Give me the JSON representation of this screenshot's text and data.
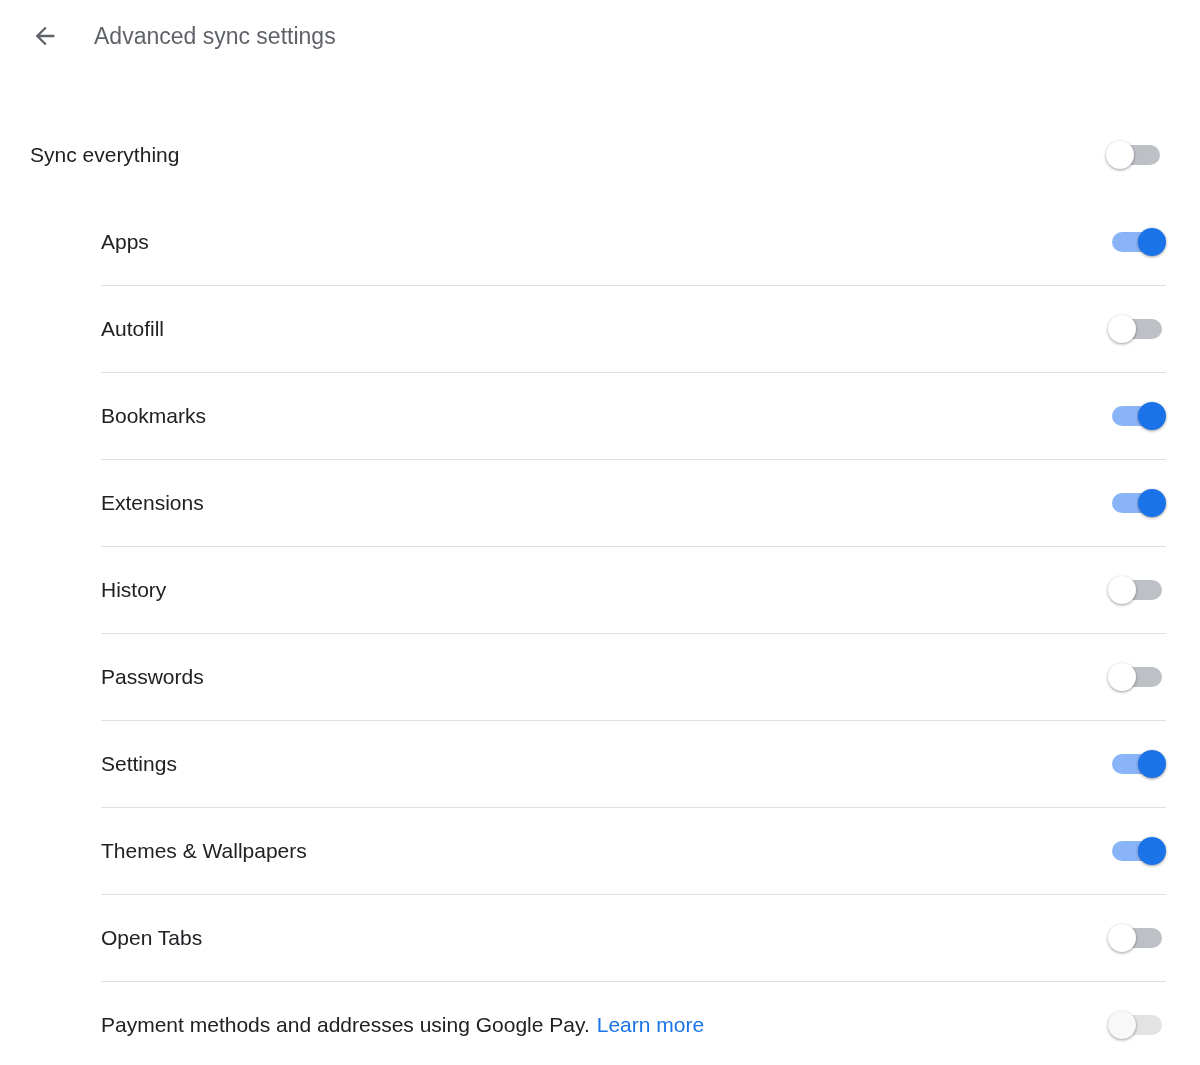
{
  "header": {
    "title": "Advanced sync settings"
  },
  "sync_everything": {
    "label": "Sync everything",
    "on": false,
    "disabled": false
  },
  "items": [
    {
      "label": "Apps",
      "on": true,
      "disabled": false
    },
    {
      "label": "Autofill",
      "on": false,
      "disabled": false
    },
    {
      "label": "Bookmarks",
      "on": true,
      "disabled": false
    },
    {
      "label": "Extensions",
      "on": true,
      "disabled": false
    },
    {
      "label": "History",
      "on": false,
      "disabled": false
    },
    {
      "label": "Passwords",
      "on": false,
      "disabled": false
    },
    {
      "label": "Settings",
      "on": true,
      "disabled": false
    },
    {
      "label": "Themes & Wallpapers",
      "on": true,
      "disabled": false
    },
    {
      "label": "Open Tabs",
      "on": false,
      "disabled": false
    },
    {
      "label": "Payment methods and addresses using Google Pay.",
      "link": "Learn more",
      "on": false,
      "disabled": true
    }
  ]
}
